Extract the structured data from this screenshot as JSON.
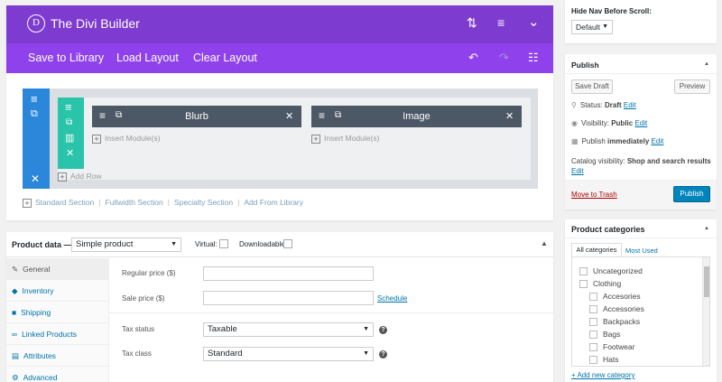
{
  "divi": {
    "logo_letter": "D",
    "title": "The Divi Builder",
    "toolbar": {
      "save_to_library": "Save to Library",
      "load_layout": "Load Layout",
      "clear_layout": "Clear Layout"
    },
    "modules": [
      {
        "label": "Blurb",
        "insert": "Insert Module(s)"
      },
      {
        "label": "Image",
        "insert": "Insert Module(s)"
      }
    ],
    "add_row": "Add Row",
    "section_links": [
      "Standard Section",
      "Fullwidth Section",
      "Specialty Section",
      "Add From Library"
    ],
    "colors": {
      "header": "#7e3bd0",
      "toolbar": "#8f42ec",
      "section": "#2b87da",
      "row": "#29c4a9",
      "module": "#4c5866"
    }
  },
  "product_data": {
    "title": "Product data —",
    "type_value": "Simple product",
    "virtual_label": "Virtual:",
    "downloadable_label": "Downloadable:",
    "tabs": [
      "General",
      "Inventory",
      "Shipping",
      "Linked Products",
      "Attributes",
      "Advanced"
    ],
    "fields": {
      "regular_price_label": "Regular price ($)",
      "sale_price_label": "Sale price ($)",
      "schedule_link": "Schedule",
      "tax_status_label": "Tax status",
      "tax_status_value": "Taxable",
      "tax_class_label": "Tax class",
      "tax_class_value": "Standard"
    }
  },
  "hide_nav": {
    "label": "Hide Nav Before Scroll:",
    "value": "Default"
  },
  "publish": {
    "title": "Publish",
    "save_draft": "Save Draft",
    "preview": "Preview",
    "status_label": "Status:",
    "status_value": "Draft",
    "visibility_label": "Visibility:",
    "visibility_value": "Public",
    "publish_label": "Publish",
    "publish_value": "immediately",
    "edit": "Edit",
    "catalog_label": "Catalog visibility:",
    "catalog_value": "Shop and search results",
    "move_to_trash": "Move to Trash",
    "publish_button": "Publish",
    "accent": "#0085ba"
  },
  "categories": {
    "title": "Product categories",
    "tab_all": "All categories",
    "tab_most_used": "Most Used",
    "items": [
      "Uncategorized",
      "Clothing",
      "Accesories",
      "Accessories",
      "Backpacks",
      "Bags",
      "Footwear",
      "Hats"
    ],
    "add_new": "+ Add new category"
  }
}
